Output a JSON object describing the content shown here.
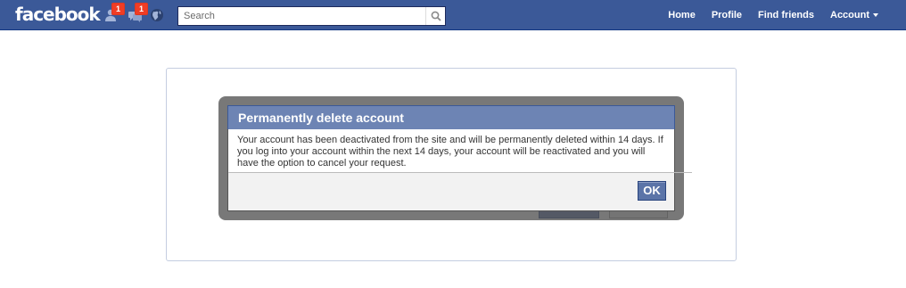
{
  "header": {
    "logo_text": "facebook",
    "friend_requests_badge": "1",
    "messages_badge": "1",
    "search": {
      "placeholder": "Search"
    },
    "nav": {
      "home": "Home",
      "profile": "Profile",
      "find_friends": "Find friends",
      "account": "Account"
    }
  },
  "dialog": {
    "title": "Permanently delete account",
    "message": "Your account has been deactivated from the site and will be permanently deleted within 14 days. If you log into your account within the next 14 days, your account will be reactivated and you will have the option to cancel your request.",
    "ok_label": "OK"
  },
  "colors": {
    "brand_blue": "#3b5998",
    "dialog_header": "#6d84b4",
    "notification_red": "#f03d25"
  },
  "icons": [
    "friend-requests-icon",
    "messages-icon",
    "notifications-globe-icon",
    "search-icon",
    "chevron-down-icon"
  ]
}
